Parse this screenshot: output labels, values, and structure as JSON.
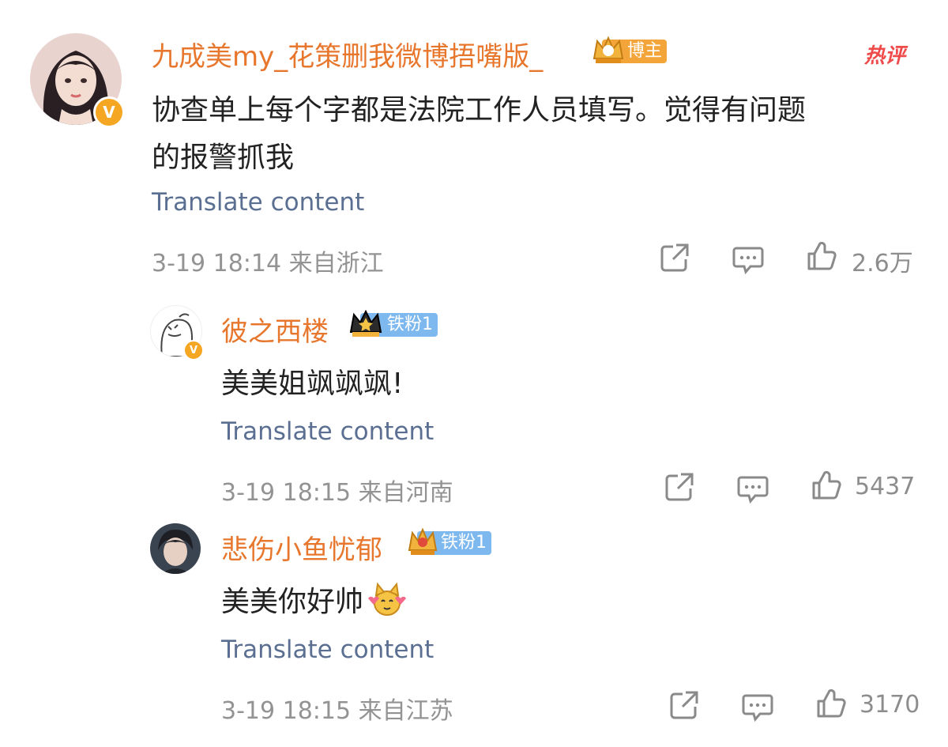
{
  "comments": [
    {
      "username": "九成美my_花策删我微博捂嘴版_",
      "badge": "博主",
      "hot_label": "热评",
      "text_line1": "协查单上每个字都是法院工作人员填写。觉得有问题",
      "text_line2": "的报警抓我",
      "translate": "Translate content",
      "meta": "3-19 18:14  来自浙江",
      "likes": "2.6万",
      "verified": "V"
    },
    {
      "username": "彼之西楼",
      "badge": "铁粉1",
      "text": "美美姐飒飒飒!",
      "translate": "Translate content",
      "meta": "3-19 18:15  来自河南",
      "likes": "5437",
      "verified": "V"
    },
    {
      "username": "悲伤小鱼忧郁",
      "badge": "铁粉1",
      "text": "美美你好帅",
      "translate": "Translate content",
      "meta": "3-19 18:15  来自江苏",
      "likes": "3170"
    }
  ],
  "colors": {
    "username": "#e8772e",
    "translate": "#5a6f91",
    "meta": "#939393",
    "hot": "#f04b4b",
    "verified": "#f5a623",
    "fan_badge": "#7db8ee",
    "blogger_badge": "#f4a53a"
  },
  "icons": [
    "share-icon",
    "comment-icon",
    "like-icon",
    "crown-icon",
    "verified-icon",
    "emoji-icon"
  ]
}
